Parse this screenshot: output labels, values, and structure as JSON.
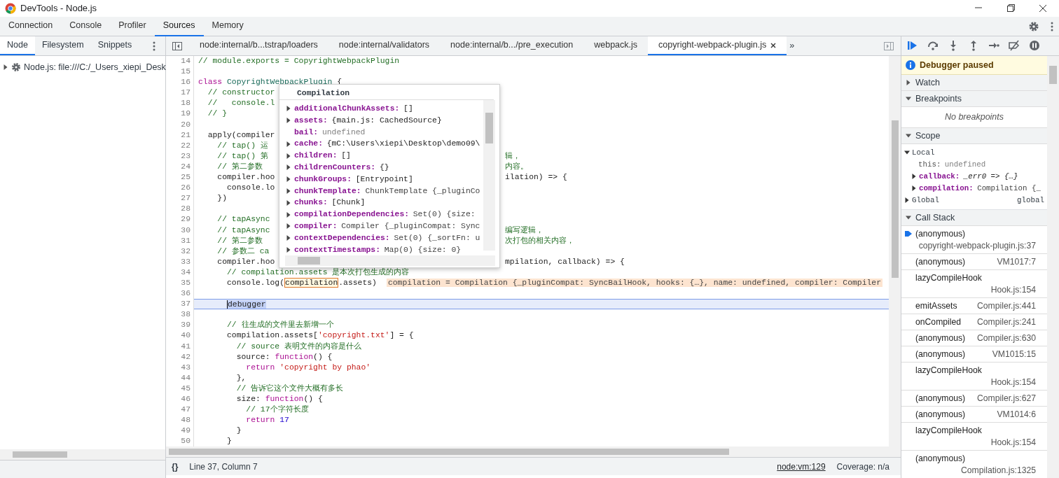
{
  "window": {
    "title": "DevTools - Node.js"
  },
  "main_tabs": [
    {
      "label": "Connection",
      "selected": false
    },
    {
      "label": "Console",
      "selected": false
    },
    {
      "label": "Profiler",
      "selected": false
    },
    {
      "label": "Sources",
      "selected": true
    },
    {
      "label": "Memory",
      "selected": false
    }
  ],
  "navigator": {
    "tabs": [
      {
        "label": "Node",
        "selected": true
      },
      {
        "label": "Filesystem",
        "selected": false
      },
      {
        "label": "Snippets",
        "selected": false
      }
    ],
    "tree": [
      {
        "label": "Node.js: file:///C:/_Users_xiepi_Desk",
        "expanded": false
      }
    ]
  },
  "editor": {
    "tabs": [
      {
        "label": "node:internal/b...tstrap/loaders",
        "selected": false
      },
      {
        "label": "node:internal/validators",
        "selected": false
      },
      {
        "label": "node:internal/b.../pre_execution",
        "selected": false
      },
      {
        "label": "webpack.js",
        "selected": false
      },
      {
        "label": "copyright-webpack-plugin.js",
        "selected": true
      }
    ],
    "overflow": "»",
    "lines": [
      {
        "number": "14",
        "current": false,
        "tokens": [
          {
            "kind": "comment",
            "text": "// module.exports = CopyrightWebpackPlugin"
          }
        ]
      },
      {
        "number": "15",
        "current": false
      },
      {
        "number": "16",
        "current": false,
        "tokens": [
          {
            "kind": "keyword",
            "text": "class"
          },
          {
            "kind": "class",
            "text": " CopyrightWebpackPlugin"
          },
          {
            "kind": "plain",
            "text": " {"
          }
        ]
      },
      {
        "number": "17",
        "current": false,
        "tokens": [
          {
            "kind": "comment",
            "text": "  // constructor"
          }
        ]
      },
      {
        "number": "18",
        "current": false,
        "tokens": [
          {
            "kind": "comment",
            "text": "  //   console.l"
          }
        ]
      },
      {
        "number": "19",
        "current": false,
        "tokens": [
          {
            "kind": "comment",
            "text": "  // }"
          }
        ]
      },
      {
        "number": "20",
        "current": false
      },
      {
        "number": "21",
        "current": false,
        "tokens": [
          {
            "kind": "plain",
            "text": "  apply(compiler"
          }
        ]
      },
      {
        "number": "22",
        "current": false,
        "tokens": [
          {
            "kind": "comment",
            "text": "    // tap() 运"
          }
        ]
      },
      {
        "number": "23",
        "current": false,
        "tokens": [
          {
            "kind": "comment",
            "text": "    // tap() 第"
          }
        ],
        "after": [
          {
            "kind": "comment",
            "text": "辑，"
          }
        ]
      },
      {
        "number": "24",
        "current": false,
        "tokens": [
          {
            "kind": "comment",
            "text": "    // 第二参数"
          }
        ],
        "after": [
          {
            "kind": "comment",
            "text": "内容。"
          }
        ]
      },
      {
        "number": "25",
        "current": false,
        "tokens": [
          {
            "kind": "plain",
            "text": "    compiler.hoo"
          }
        ],
        "after": [
          {
            "kind": "plain",
            "text": "ilation) => {"
          }
        ]
      },
      {
        "number": "26",
        "current": false,
        "tokens": [
          {
            "kind": "plain",
            "text": "      console.lo"
          }
        ]
      },
      {
        "number": "27",
        "current": false,
        "tokens": [
          {
            "kind": "plain",
            "text": "    })"
          }
        ]
      },
      {
        "number": "28",
        "current": false
      },
      {
        "number": "29",
        "current": false,
        "tokens": [
          {
            "kind": "comment",
            "text": "    // tapAsync"
          }
        ]
      },
      {
        "number": "30",
        "current": false,
        "tokens": [
          {
            "kind": "comment",
            "text": "    // tapAsync"
          }
        ],
        "after": [
          {
            "kind": "comment",
            "text": "编写逻辑，"
          }
        ]
      },
      {
        "number": "31",
        "current": false,
        "tokens": [
          {
            "kind": "comment",
            "text": "    // 第二参数"
          }
        ],
        "after": [
          {
            "kind": "comment",
            "text": "次打包的相关内容，"
          }
        ]
      },
      {
        "number": "32",
        "current": false,
        "tokens": [
          {
            "kind": "comment",
            "text": "    // 参数二 ca"
          }
        ]
      },
      {
        "number": "33",
        "current": false,
        "tokens": [
          {
            "kind": "plain",
            "text": "    compiler.hoo"
          }
        ],
        "after": [
          {
            "kind": "plain",
            "text": "mpilation, callback) => {"
          }
        ]
      },
      {
        "number": "34",
        "current": false,
        "tokens": [
          {
            "kind": "comment",
            "text": "      // compilation.assets 是本次打包生成的内容"
          }
        ]
      },
      {
        "number": "35",
        "current": false,
        "tokens": [
          {
            "kind": "plain",
            "text": "      console.log("
          },
          {
            "kind": "hover",
            "text": "compilation"
          },
          {
            "kind": "plain",
            "text": ".assets)"
          }
        ],
        "inline_value": "compilation = Compilation {_pluginCompat: SyncBailHook, hooks: {…}, name: undefined, compiler: Compiler"
      },
      {
        "number": "36",
        "current": false
      },
      {
        "number": "37",
        "current": true,
        "tokens": [
          {
            "kind": "selection",
            "text": "      debugger"
          }
        ]
      },
      {
        "number": "38",
        "current": false
      },
      {
        "number": "39",
        "current": false,
        "tokens": [
          {
            "kind": "comment",
            "text": "      // 往生成的文件里去新增一个"
          }
        ]
      },
      {
        "number": "40",
        "current": false,
        "tokens": [
          {
            "kind": "plain",
            "text": "      compilation.assets["
          },
          {
            "kind": "string",
            "text": "'copyright.txt'"
          },
          {
            "kind": "plain",
            "text": "] = {"
          }
        ]
      },
      {
        "number": "41",
        "current": false,
        "tokens": [
          {
            "kind": "comment",
            "text": "        // source 表明文件的内容是什么"
          }
        ]
      },
      {
        "number": "42",
        "current": false,
        "tokens": [
          {
            "kind": "plain",
            "text": "        source: "
          },
          {
            "kind": "keyword",
            "text": "function"
          },
          {
            "kind": "plain",
            "text": "() {"
          }
        ]
      },
      {
        "number": "43",
        "current": false,
        "tokens": [
          {
            "kind": "keyword",
            "text": "          return"
          },
          {
            "kind": "string",
            "text": " 'copyright by phao'"
          }
        ]
      },
      {
        "number": "44",
        "current": false,
        "tokens": [
          {
            "kind": "plain",
            "text": "        },"
          }
        ]
      },
      {
        "number": "45",
        "current": false,
        "tokens": [
          {
            "kind": "comment",
            "text": "        // 告诉它这个文件大概有多长"
          }
        ]
      },
      {
        "number": "46",
        "current": false,
        "tokens": [
          {
            "kind": "plain",
            "text": "        size: "
          },
          {
            "kind": "keyword",
            "text": "function"
          },
          {
            "kind": "plain",
            "text": "() {"
          }
        ]
      },
      {
        "number": "47",
        "current": false,
        "tokens": [
          {
            "kind": "comment",
            "text": "          // 17个字符长度"
          }
        ]
      },
      {
        "number": "48",
        "current": false,
        "tokens": [
          {
            "kind": "keyword",
            "text": "          return"
          },
          {
            "kind": "number",
            "text": " 17"
          }
        ]
      },
      {
        "number": "49",
        "current": false,
        "tokens": [
          {
            "kind": "plain",
            "text": "        }"
          }
        ]
      },
      {
        "number": "50",
        "current": false,
        "tokens": [
          {
            "kind": "plain",
            "text": "      }"
          }
        ]
      }
    ],
    "popover": {
      "title": "Compilation",
      "properties": [
        {
          "name": "additionalChunkAssets:",
          "value": "[]",
          "expandable": true,
          "kind": "object"
        },
        {
          "name": "assets:",
          "value": "{main.js: CachedSource}",
          "expandable": true,
          "kind": "object"
        },
        {
          "name": "bail:",
          "value": "undefined",
          "expandable": false,
          "kind": "undefined"
        },
        {
          "name": "cache:",
          "value": "{mC:\\Users\\xiepi\\Desktop\\demo09\\",
          "expandable": true,
          "kind": "object"
        },
        {
          "name": "children:",
          "value": "[]",
          "expandable": true,
          "kind": "object"
        },
        {
          "name": "childrenCounters:",
          "value": "{}",
          "expandable": true,
          "kind": "object"
        },
        {
          "name": "chunkGroups:",
          "value": "[Entrypoint]",
          "expandable": true,
          "kind": "object"
        },
        {
          "name": "chunkTemplate:",
          "value": "ChunkTemplate {_pluginCo",
          "expandable": true,
          "kind": "class"
        },
        {
          "name": "chunks:",
          "value": "[Chunk]",
          "expandable": true,
          "kind": "object"
        },
        {
          "name": "compilationDependencies:",
          "value": "Set(0) {size:",
          "expandable": true,
          "kind": "class"
        },
        {
          "name": "compiler:",
          "value": "Compiler {_pluginCompat: Sync",
          "expandable": true,
          "kind": "class"
        },
        {
          "name": "contextDependencies:",
          "value": "Set(0) {_sortFn: u",
          "expandable": true,
          "kind": "class"
        },
        {
          "name": "contextTimestamps:",
          "value": "Map(0) {size: 0}",
          "expandable": true,
          "kind": "class"
        }
      ]
    }
  },
  "status_bar": {
    "pretty_print": "{}",
    "position": "Line 37, Column 7",
    "source_link": "node:vm:129",
    "coverage": "Coverage: n/a"
  },
  "debugger": {
    "status": "Debugger paused",
    "watch": {
      "title": "Watch",
      "expanded": false
    },
    "breakpoints": {
      "title": "Breakpoints",
      "expanded": true,
      "empty_text": "No breakpoints"
    },
    "scope": {
      "title": "Scope",
      "expanded": true,
      "scopes": [
        {
          "name": "Local",
          "expanded": true,
          "variables": [
            {
              "name": "this:",
              "value": "undefined",
              "expandable": false,
              "kind": "undefined"
            },
            {
              "name": "callback:",
              "value": "_err0 => {…}",
              "expandable": true,
              "kind": "function"
            },
            {
              "name": "compilation:",
              "value": "Compilation {_",
              "expandable": true,
              "kind": "class"
            }
          ]
        },
        {
          "name": "Global",
          "expanded": false,
          "value": "global"
        }
      ]
    },
    "call_stack": {
      "title": "Call Stack",
      "expanded": true,
      "frames": [
        {
          "function": "(anonymous)",
          "location": "copyright-webpack-plugin.js:37",
          "current": true
        },
        {
          "function": "(anonymous)",
          "location": "VM1017:7",
          "current": false
        },
        {
          "function": "lazyCompileHook",
          "location": "Hook.js:154",
          "current": false
        },
        {
          "function": "emitAssets",
          "location": "Compiler.js:441",
          "current": false
        },
        {
          "function": "onCompiled",
          "location": "Compiler.js:241",
          "current": false
        },
        {
          "function": "(anonymous)",
          "location": "Compiler.js:630",
          "current": false
        },
        {
          "function": "(anonymous)",
          "location": "VM1015:15",
          "current": false
        },
        {
          "function": "lazyCompileHook",
          "location": "Hook.js:154",
          "current": false
        },
        {
          "function": "(anonymous)",
          "location": "Compiler.js:627",
          "current": false
        },
        {
          "function": "(anonymous)",
          "location": "VM1014:6",
          "current": false
        },
        {
          "function": "lazyCompileHook",
          "location": "Hook.js:154",
          "current": false
        },
        {
          "function": "(anonymous)",
          "location": "Compilation.js:1325",
          "current": false
        }
      ]
    }
  }
}
